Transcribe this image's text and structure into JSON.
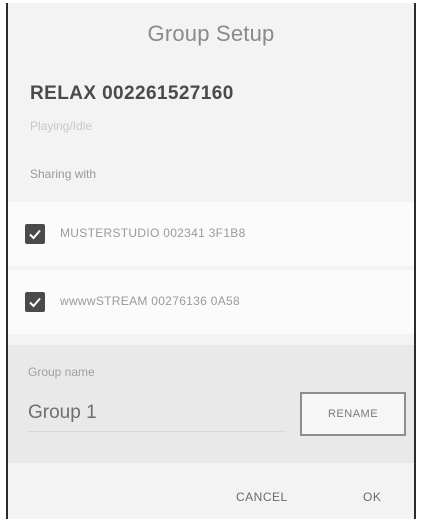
{
  "dialog": {
    "title": "Group Setup",
    "device_name": "RELAX 002261527160",
    "device_status": "Playing/Idle",
    "sharing_label": "Sharing with",
    "members": [
      {
        "label": "MUSTERSTUDIO 002341 3F1B8",
        "checked": true
      },
      {
        "label": "wwwwSTREAM 00276136 0A58",
        "checked": true
      }
    ],
    "group_name_label": "Group name",
    "group_name_value": "Group 1",
    "rename_label": "RENAME",
    "cancel_label": "CANCEL",
    "ok_label": "OK"
  }
}
